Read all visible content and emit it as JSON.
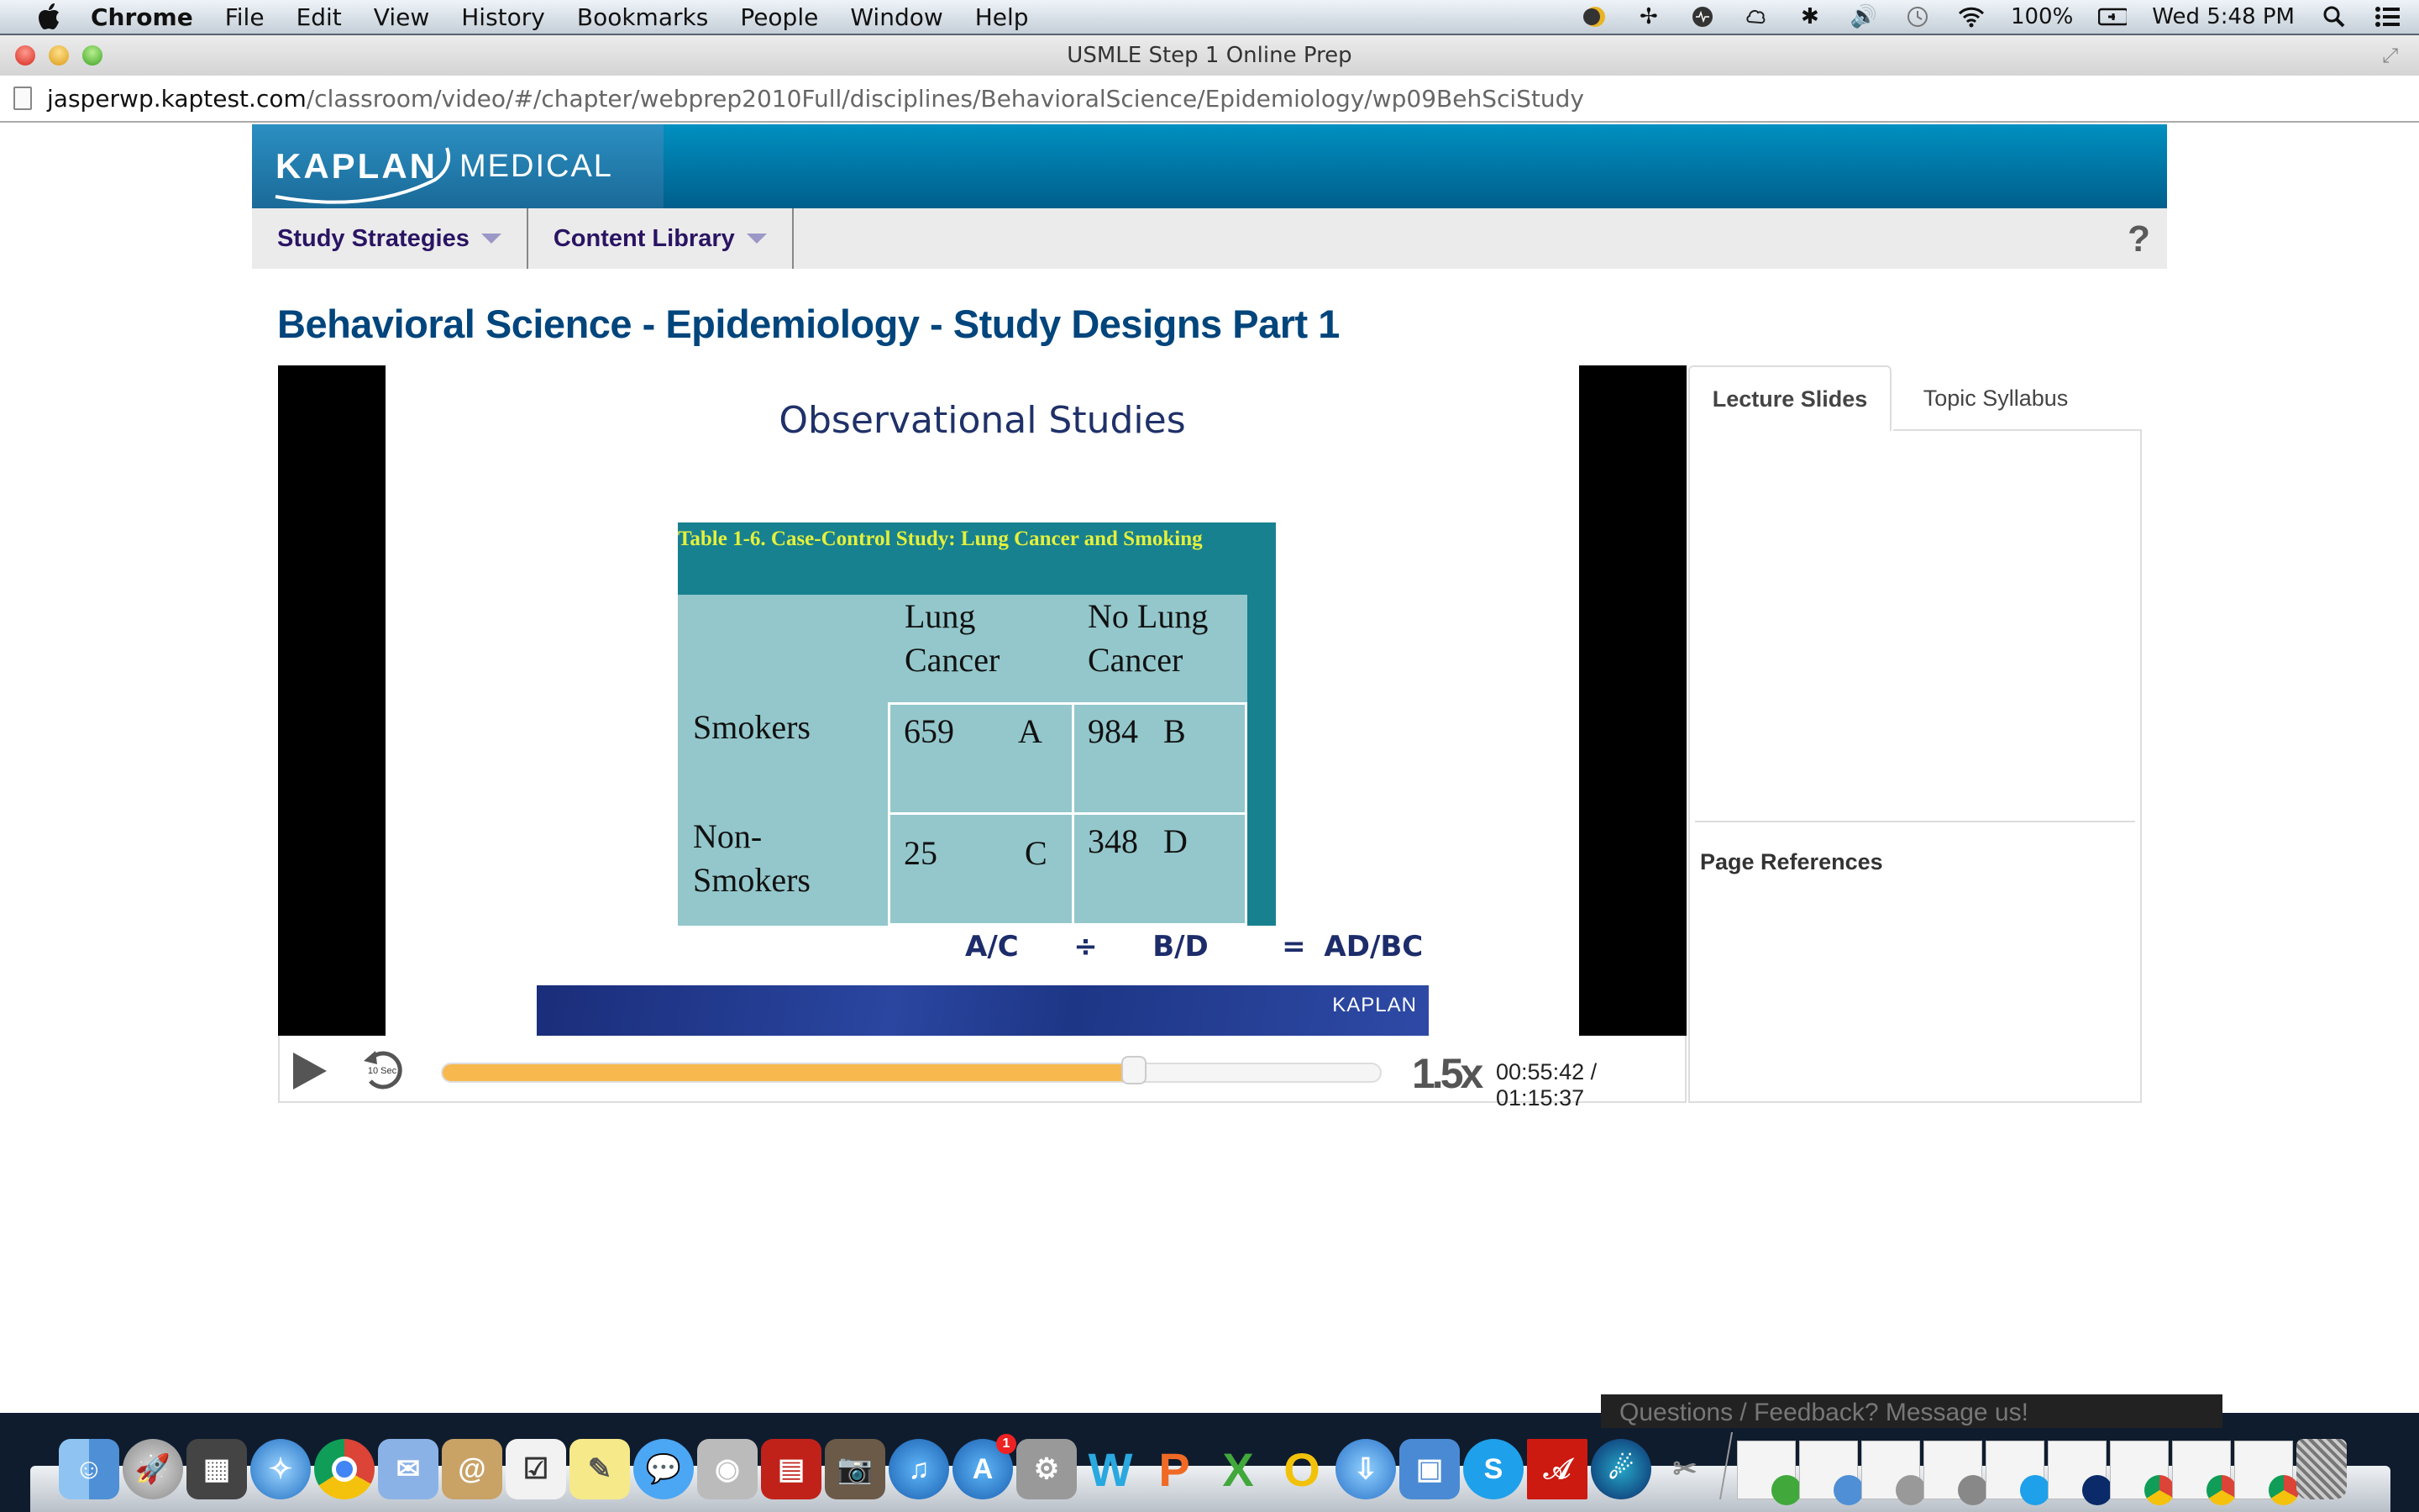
{
  "menubar": {
    "app_name": "Chrome",
    "items": [
      "File",
      "Edit",
      "View",
      "History",
      "Bookmarks",
      "People",
      "Window",
      "Help"
    ],
    "status_icons": [
      "night-mode-icon",
      "fan-icon",
      "audio-hijack-icon",
      "cloud-app-icon",
      "bluetooth-icon",
      "volume-icon",
      "time-machine-icon",
      "wifi-icon"
    ],
    "battery": "100%",
    "clock": "Wed 5:48 PM"
  },
  "window": {
    "title": "USMLE Step 1 Online Prep"
  },
  "urlbar": {
    "host": "jasperwp.kaptest.com",
    "path": "/classroom/video/#/chapter/webprep2010Full/disciplines/BehavioralScience/Epidemiology/wp09BehSciStudy"
  },
  "header": {
    "logo_kaplan": "KAPLAN",
    "logo_medical": "MEDICAL",
    "brand_color": "#0077a8"
  },
  "nav": {
    "items": [
      {
        "label": "Study Strategies"
      },
      {
        "label": "Content Library"
      }
    ],
    "help_label": "?"
  },
  "page": {
    "title": "Behavioral Science - Epidemiology - Study Designs Part 1"
  },
  "slide": {
    "title": "Observational Studies",
    "table_caption": "Table 1-6.   Case-Control Study: Lung Cancer and Smoking",
    "col_headers": [
      "Lung Cancer",
      "No Lung Cancer"
    ],
    "col_header_lines": [
      [
        "Lung",
        "Cancer"
      ],
      [
        "No Lung",
        "Cancer"
      ]
    ],
    "rows": [
      {
        "label_lines": [
          "Smokers"
        ],
        "cells": [
          {
            "value": "659",
            "letter": "A"
          },
          {
            "value": "984",
            "letter": "B"
          }
        ]
      },
      {
        "label_lines": [
          "Non-",
          "Smokers"
        ],
        "cells": [
          {
            "value": "25",
            "letter": "C"
          },
          {
            "value": "348",
            "letter": "D"
          }
        ]
      }
    ],
    "formula": "A/C   ÷   B/D    = AD/BC",
    "banner_logo": "KAPLAN"
  },
  "player": {
    "speed": "1.5x",
    "rewind_label": "10 Sec",
    "current_time": "00:55:42",
    "duration": "01:15:37",
    "time_display": "00:55:42 / 01:15:37",
    "progress_fraction": 0.7366,
    "progress_color": "#f7b84e"
  },
  "side_panel": {
    "tabs": [
      {
        "label": "Lecture Slides",
        "active": true
      },
      {
        "label": "Topic Syllabus",
        "active": false
      }
    ],
    "page_references_title": "Page References"
  },
  "dock": {
    "apps": [
      "finder",
      "launchpad",
      "mission-control",
      "safari",
      "chrome",
      "mail",
      "contacts",
      "reminders",
      "notes",
      "messages",
      "facetime",
      "photo-booth",
      "iphoto",
      "itunes",
      "app-store",
      "system-preferences",
      "word",
      "powerpoint",
      "excel",
      "outlook",
      "downloads",
      "remote-desktop",
      "skype",
      "acrobat",
      "xcode-instruments",
      "utilities"
    ],
    "app_store_badge": "1",
    "minimized_windows": 9,
    "feedback_text": "Questions / Feedback? Message us!"
  }
}
